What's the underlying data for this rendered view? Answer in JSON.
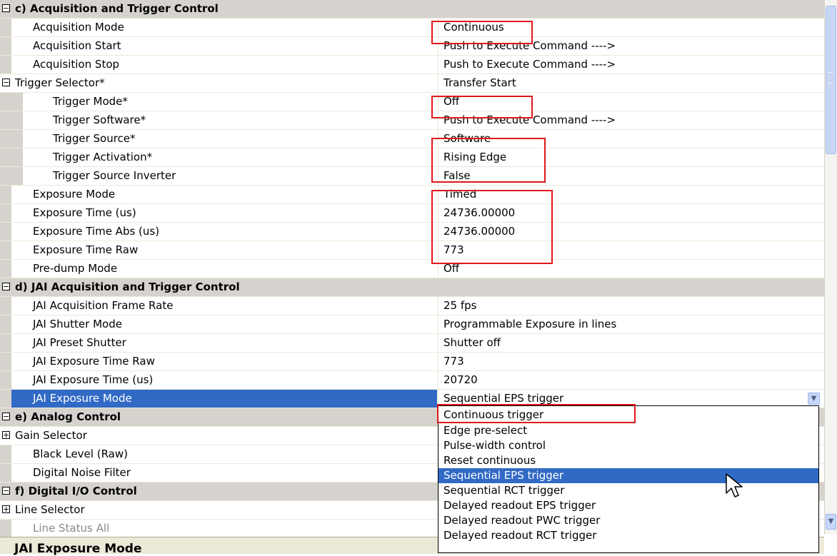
{
  "categories": {
    "c": "c) Acquisition and Trigger Control",
    "d": "d) JAI Acquisition and Trigger Control",
    "e": "e) Analog Control",
    "f": "f) Digital I/O Control"
  },
  "expander": {
    "collapse": "−",
    "expand": "+"
  },
  "rows": {
    "acquisition_mode": {
      "label": "Acquisition Mode",
      "value": "Continuous"
    },
    "acquisition_start": {
      "label": "Acquisition Start",
      "value": "Push to Execute Command ---->"
    },
    "acquisition_stop": {
      "label": "Acquisition Stop",
      "value": "Push to Execute Command ---->"
    },
    "trigger_selector": {
      "label": "Trigger Selector*",
      "value": "Transfer Start"
    },
    "trigger_mode": {
      "label": "Trigger Mode*",
      "value": "Off"
    },
    "trigger_software": {
      "label": "Trigger Software*",
      "value": "Push to Execute Command ---->"
    },
    "trigger_source": {
      "label": "Trigger Source*",
      "value": "Software"
    },
    "trigger_activation": {
      "label": "Trigger Activation*",
      "value": "Rising Edge"
    },
    "trigger_source_inverter": {
      "label": "Trigger Source Inverter",
      "value": "False"
    },
    "exposure_mode": {
      "label": "Exposure Mode",
      "value": "Timed"
    },
    "exposure_time": {
      "label": "Exposure Time (us)",
      "value": "24736.00000"
    },
    "exposure_time_abs": {
      "label": "Exposure Time Abs (us)",
      "value": "24736.00000"
    },
    "exposure_time_raw": {
      "label": "Exposure Time Raw",
      "value": "773"
    },
    "predump_mode": {
      "label": "Pre-dump Mode",
      "value": "Off"
    },
    "jai_frame_rate": {
      "label": "JAI Acquisition Frame Rate",
      "value": "25 fps"
    },
    "jai_shutter_mode": {
      "label": "JAI Shutter Mode",
      "value": "Programmable Exposure in lines"
    },
    "jai_preset_shutter": {
      "label": "JAI Preset Shutter",
      "value": "Shutter off"
    },
    "jai_exposure_raw": {
      "label": "JAI Exposure Time Raw",
      "value": "773"
    },
    "jai_exposure_us": {
      "label": "JAI Exposure Time (us)",
      "value": "20720"
    },
    "jai_exposure_mode": {
      "label": "JAI Exposure Mode",
      "value": "Sequential EPS trigger"
    },
    "gain_selector": {
      "label": "Gain Selector"
    },
    "black_level": {
      "label": "Black Level (Raw)"
    },
    "digital_noise": {
      "label": "Digital Noise Filter"
    },
    "line_selector": {
      "label": "Line Selector"
    },
    "line_status_all": {
      "label": "Line Status All"
    }
  },
  "dropdown_options": [
    "Continuous trigger",
    "Edge pre-select",
    "Pulse-width control",
    "Reset continuous",
    "Sequential EPS trigger",
    "Sequential RCT trigger",
    "Delayed readout EPS trigger",
    "Delayed readout PWC trigger",
    "Delayed readout RCT trigger"
  ],
  "dropdown_selected": "Sequential EPS trigger",
  "description_title": "JAI Exposure Mode",
  "colors": {
    "selection": "#316ac5",
    "highlight_box": "#e0161b",
    "category_bg": "#d6d3ce"
  },
  "icons": {
    "combo": "chevron-down-icon",
    "cursor": "mouse-pointer-icon"
  }
}
